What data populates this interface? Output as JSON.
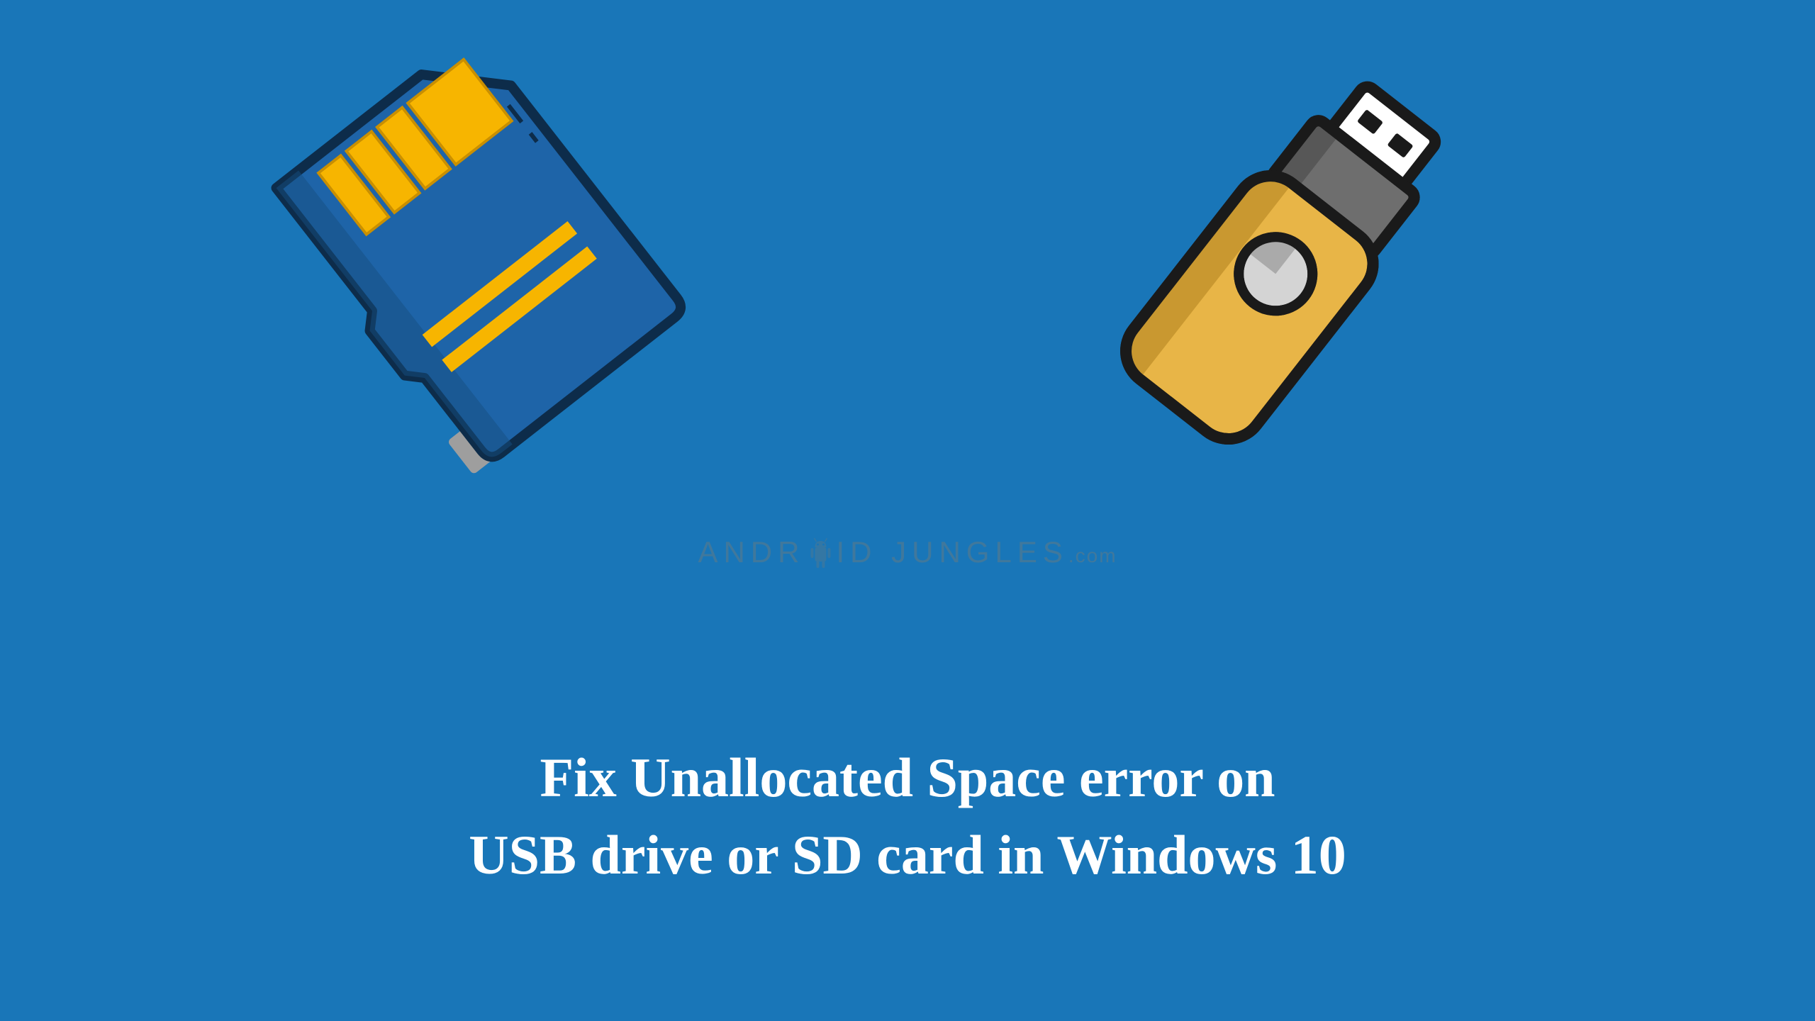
{
  "colors": {
    "background": "#1976b8",
    "sdCardBody": "#1e64a8",
    "sdCardContacts": "#f7b500",
    "sdCardOutline": "#0d2c4a",
    "usbBody": "#e8b547",
    "usbCap": "#6e6e6e",
    "usbOutline": "#1a1a1a",
    "textWhite": "#ffffff",
    "watermark": "#5a7a8a"
  },
  "watermark": {
    "text_part1": "ANDR",
    "text_part2": "ID",
    "text_part3": "JUNGLES",
    "text_suffix": ".com"
  },
  "title": {
    "line1": "Fix Unallocated Space error on",
    "line2": "USB drive or SD card in Windows 10"
  },
  "icons": {
    "sd_card": "sd-card-icon",
    "usb_drive": "usb-drive-icon",
    "android_robot": "android-robot-icon"
  }
}
